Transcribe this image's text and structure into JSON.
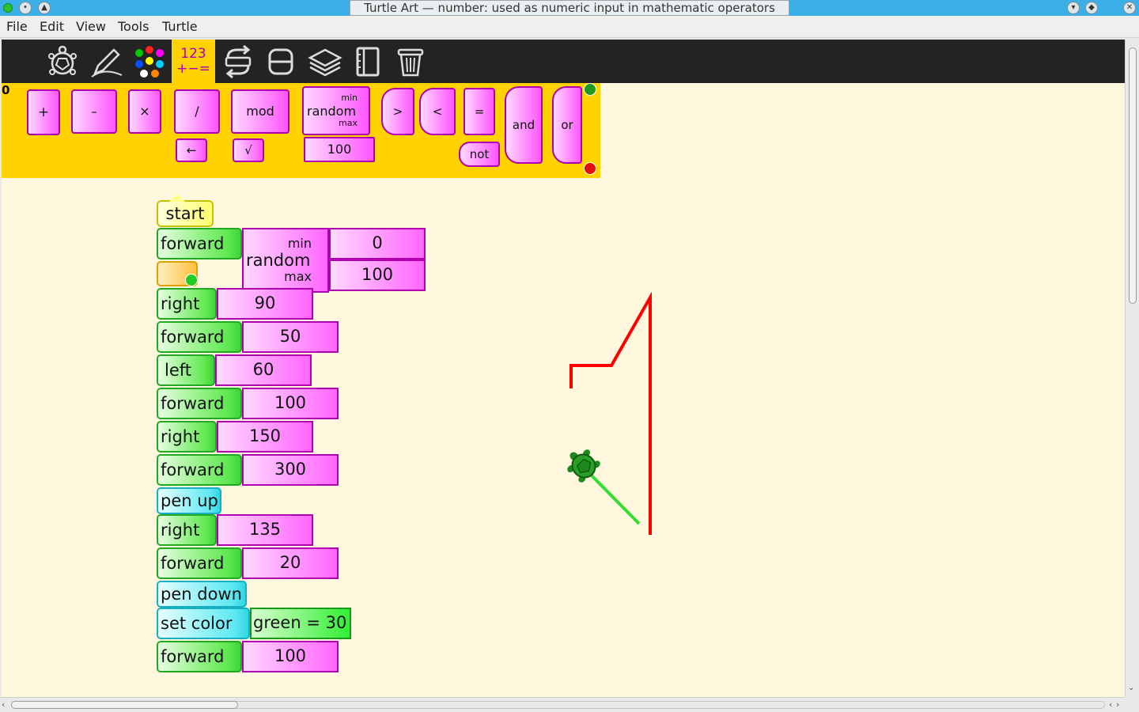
{
  "window": {
    "title": "Turtle Art — number: used as numeric input in mathematic operators"
  },
  "menu": [
    "File",
    "Edit",
    "View",
    "Tools",
    "Turtle"
  ],
  "toolbar": {
    "numbers_tab_top": "123",
    "numbers_tab_bottom": "+−="
  },
  "palette": {
    "plus": "+",
    "minus": "–",
    "times": "×",
    "divide": "/",
    "mod": "mod",
    "random": "random",
    "random_min": "min",
    "random_max": "max",
    "greater": ">",
    "less": "<",
    "equal": "=",
    "and": "and",
    "or": "or",
    "not": "not",
    "identity": "←",
    "sqrt": "√",
    "number": "100"
  },
  "program": {
    "start": "start",
    "forward1": {
      "label": "forward"
    },
    "random": {
      "label": "random",
      "min_label": "min",
      "max_label": "max",
      "min": "0",
      "max": "100"
    },
    "right1": {
      "label": "right",
      "value": "90"
    },
    "forward2": {
      "label": "forward",
      "value": "50"
    },
    "left1": {
      "label": "left",
      "value": "60"
    },
    "forward3": {
      "label": "forward",
      "value": "100"
    },
    "right2": {
      "label": "right",
      "value": "150"
    },
    "forward4": {
      "label": "forward",
      "value": "300"
    },
    "penup": "pen up",
    "right3": {
      "label": "right",
      "value": "135"
    },
    "forward5": {
      "label": "forward",
      "value": "20"
    },
    "pendown": "pen down",
    "setcolor": {
      "label": "set color",
      "value": "green = 30"
    },
    "forward6": {
      "label": "forward",
      "value": "100"
    }
  },
  "colors": {
    "red_path": "#ff0000",
    "green_path": "#33dd33",
    "turtle": "#1e8a1e"
  }
}
